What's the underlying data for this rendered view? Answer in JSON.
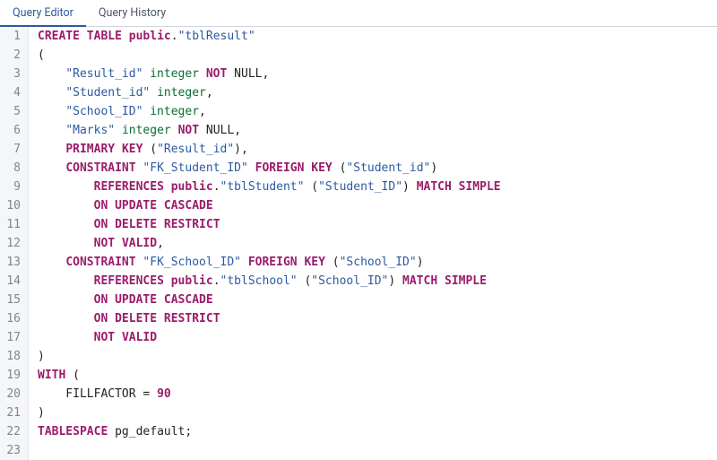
{
  "tabs": {
    "editor": "Query Editor",
    "history": "Query History",
    "active": "editor"
  },
  "code": {
    "lines": [
      [
        {
          "c": "kw",
          "t": "CREATE"
        },
        {
          "c": "plain",
          "t": " "
        },
        {
          "c": "kw",
          "t": "TABLE"
        },
        {
          "c": "plain",
          "t": " "
        },
        {
          "c": "kw",
          "t": "public"
        },
        {
          "c": "punct",
          "t": "."
        },
        {
          "c": "str",
          "t": "\"tblResult\""
        }
      ],
      [
        {
          "c": "punct",
          "t": "("
        }
      ],
      [
        {
          "c": "plain",
          "t": "    "
        },
        {
          "c": "str",
          "t": "\"Result_id\""
        },
        {
          "c": "plain",
          "t": " "
        },
        {
          "c": "type",
          "t": "integer"
        },
        {
          "c": "plain",
          "t": " "
        },
        {
          "c": "kw",
          "t": "NOT"
        },
        {
          "c": "plain",
          "t": " "
        },
        {
          "c": "plain",
          "t": "NULL"
        },
        {
          "c": "punct",
          "t": ","
        }
      ],
      [
        {
          "c": "plain",
          "t": "    "
        },
        {
          "c": "str",
          "t": "\"Student_id\""
        },
        {
          "c": "plain",
          "t": " "
        },
        {
          "c": "type",
          "t": "integer"
        },
        {
          "c": "punct",
          "t": ","
        }
      ],
      [
        {
          "c": "plain",
          "t": "    "
        },
        {
          "c": "str",
          "t": "\"School_ID\""
        },
        {
          "c": "plain",
          "t": " "
        },
        {
          "c": "type",
          "t": "integer"
        },
        {
          "c": "punct",
          "t": ","
        }
      ],
      [
        {
          "c": "plain",
          "t": "    "
        },
        {
          "c": "str",
          "t": "\"Marks\""
        },
        {
          "c": "plain",
          "t": " "
        },
        {
          "c": "type",
          "t": "integer"
        },
        {
          "c": "plain",
          "t": " "
        },
        {
          "c": "kw",
          "t": "NOT"
        },
        {
          "c": "plain",
          "t": " "
        },
        {
          "c": "plain",
          "t": "NULL"
        },
        {
          "c": "punct",
          "t": ","
        }
      ],
      [
        {
          "c": "plain",
          "t": "    "
        },
        {
          "c": "kw",
          "t": "PRIMARY"
        },
        {
          "c": "plain",
          "t": " "
        },
        {
          "c": "kw",
          "t": "KEY"
        },
        {
          "c": "plain",
          "t": " "
        },
        {
          "c": "punct",
          "t": "("
        },
        {
          "c": "str",
          "t": "\"Result_id\""
        },
        {
          "c": "punct",
          "t": "),"
        }
      ],
      [
        {
          "c": "plain",
          "t": "    "
        },
        {
          "c": "kw",
          "t": "CONSTRAINT"
        },
        {
          "c": "plain",
          "t": " "
        },
        {
          "c": "str",
          "t": "\"FK_Student_ID\""
        },
        {
          "c": "plain",
          "t": " "
        },
        {
          "c": "kw",
          "t": "FOREIGN"
        },
        {
          "c": "plain",
          "t": " "
        },
        {
          "c": "kw",
          "t": "KEY"
        },
        {
          "c": "plain",
          "t": " "
        },
        {
          "c": "punct",
          "t": "("
        },
        {
          "c": "str",
          "t": "\"Student_id\""
        },
        {
          "c": "punct",
          "t": ")"
        }
      ],
      [
        {
          "c": "plain",
          "t": "        "
        },
        {
          "c": "kw",
          "t": "REFERENCES"
        },
        {
          "c": "plain",
          "t": " "
        },
        {
          "c": "kw",
          "t": "public"
        },
        {
          "c": "punct",
          "t": "."
        },
        {
          "c": "str",
          "t": "\"tblStudent\""
        },
        {
          "c": "plain",
          "t": " "
        },
        {
          "c": "punct",
          "t": "("
        },
        {
          "c": "str",
          "t": "\"Student_ID\""
        },
        {
          "c": "punct",
          "t": ")"
        },
        {
          "c": "plain",
          "t": " "
        },
        {
          "c": "kw",
          "t": "MATCH"
        },
        {
          "c": "plain",
          "t": " "
        },
        {
          "c": "kw",
          "t": "SIMPLE"
        }
      ],
      [
        {
          "c": "plain",
          "t": "        "
        },
        {
          "c": "kw",
          "t": "ON"
        },
        {
          "c": "plain",
          "t": " "
        },
        {
          "c": "kw",
          "t": "UPDATE"
        },
        {
          "c": "plain",
          "t": " "
        },
        {
          "c": "kw",
          "t": "CASCADE"
        }
      ],
      [
        {
          "c": "plain",
          "t": "        "
        },
        {
          "c": "kw",
          "t": "ON"
        },
        {
          "c": "plain",
          "t": " "
        },
        {
          "c": "kw",
          "t": "DELETE"
        },
        {
          "c": "plain",
          "t": " "
        },
        {
          "c": "kw",
          "t": "RESTRICT"
        }
      ],
      [
        {
          "c": "plain",
          "t": "        "
        },
        {
          "c": "kw",
          "t": "NOT"
        },
        {
          "c": "plain",
          "t": " "
        },
        {
          "c": "kw",
          "t": "VALID"
        },
        {
          "c": "punct",
          "t": ","
        }
      ],
      [
        {
          "c": "plain",
          "t": "    "
        },
        {
          "c": "kw",
          "t": "CONSTRAINT"
        },
        {
          "c": "plain",
          "t": " "
        },
        {
          "c": "str",
          "t": "\"FK_School_ID\""
        },
        {
          "c": "plain",
          "t": " "
        },
        {
          "c": "kw",
          "t": "FOREIGN"
        },
        {
          "c": "plain",
          "t": " "
        },
        {
          "c": "kw",
          "t": "KEY"
        },
        {
          "c": "plain",
          "t": " "
        },
        {
          "c": "punct",
          "t": "("
        },
        {
          "c": "str",
          "t": "\"School_ID\""
        },
        {
          "c": "punct",
          "t": ")"
        }
      ],
      [
        {
          "c": "plain",
          "t": "        "
        },
        {
          "c": "kw",
          "t": "REFERENCES"
        },
        {
          "c": "plain",
          "t": " "
        },
        {
          "c": "kw",
          "t": "public"
        },
        {
          "c": "punct",
          "t": "."
        },
        {
          "c": "str",
          "t": "\"tblSchool\""
        },
        {
          "c": "plain",
          "t": " "
        },
        {
          "c": "punct",
          "t": "("
        },
        {
          "c": "str",
          "t": "\"School_ID\""
        },
        {
          "c": "punct",
          "t": ")"
        },
        {
          "c": "plain",
          "t": " "
        },
        {
          "c": "kw",
          "t": "MATCH"
        },
        {
          "c": "plain",
          "t": " "
        },
        {
          "c": "kw",
          "t": "SIMPLE"
        }
      ],
      [
        {
          "c": "plain",
          "t": "        "
        },
        {
          "c": "kw",
          "t": "ON"
        },
        {
          "c": "plain",
          "t": " "
        },
        {
          "c": "kw",
          "t": "UPDATE"
        },
        {
          "c": "plain",
          "t": " "
        },
        {
          "c": "kw",
          "t": "CASCADE"
        }
      ],
      [
        {
          "c": "plain",
          "t": "        "
        },
        {
          "c": "kw",
          "t": "ON"
        },
        {
          "c": "plain",
          "t": " "
        },
        {
          "c": "kw",
          "t": "DELETE"
        },
        {
          "c": "plain",
          "t": " "
        },
        {
          "c": "kw",
          "t": "RESTRICT"
        }
      ],
      [
        {
          "c": "plain",
          "t": "        "
        },
        {
          "c": "kw",
          "t": "NOT"
        },
        {
          "c": "plain",
          "t": " "
        },
        {
          "c": "kw",
          "t": "VALID"
        }
      ],
      [
        {
          "c": "punct",
          "t": ")"
        }
      ],
      [
        {
          "c": "kw",
          "t": "WITH"
        },
        {
          "c": "plain",
          "t": " "
        },
        {
          "c": "punct",
          "t": "("
        }
      ],
      [
        {
          "c": "plain",
          "t": "    FILLFACTOR "
        },
        {
          "c": "punct",
          "t": "="
        },
        {
          "c": "plain",
          "t": " "
        },
        {
          "c": "num",
          "t": "90"
        }
      ],
      [
        {
          "c": "punct",
          "t": ")"
        }
      ],
      [
        {
          "c": "kw",
          "t": "TABLESPACE"
        },
        {
          "c": "plain",
          "t": " pg_default"
        },
        {
          "c": "punct",
          "t": ";"
        }
      ],
      [
        {
          "c": "plain",
          "t": ""
        }
      ]
    ]
  }
}
